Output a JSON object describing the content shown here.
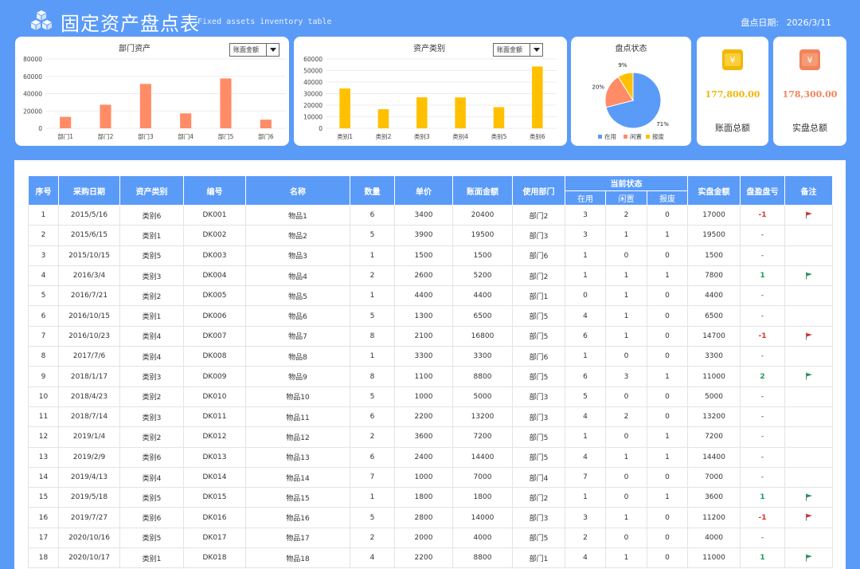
{
  "header": {
    "title": "固定资产盘点表",
    "subtitle": "Fixed assets inventory table",
    "date_label": "盘点日期:",
    "date_value": "2026/3/11"
  },
  "charts": {
    "dept": {
      "title": "部门资产",
      "dropdown": "账面金额"
    },
    "category": {
      "title": "资产类别",
      "dropdown": "账面金额"
    },
    "status": {
      "title": "盘点状态"
    }
  },
  "stats": {
    "book": {
      "value": "177,800.00",
      "label": "账面总额",
      "color": "#f2b705"
    },
    "actual": {
      "value": "178,300.00",
      "label": "实盘总额",
      "color": "#f0845a"
    }
  },
  "colors": {
    "accent": "#5b9bf8",
    "bar_orange": "#ff8c66",
    "bar_yellow": "#ffc000",
    "pie_blue": "#5b9bf8",
    "pie_orange": "#ff8c66",
    "pie_yellow": "#ffc000",
    "loss_red": "#e02b2b",
    "gain_green": "#1a9b58"
  },
  "chart_data": [
    {
      "type": "bar",
      "title": "部门资产",
      "categories": [
        "部门1",
        "部门2",
        "部门3",
        "部门4",
        "部门5",
        "部门6"
      ],
      "values": [
        13200,
        27200,
        51200,
        17200,
        57500,
        10000
      ],
      "ylim": [
        0,
        80000
      ],
      "yticks": [
        "0",
        "20000",
        "40000",
        "60000",
        "80000"
      ],
      "grid": true
    },
    {
      "type": "bar",
      "title": "资产类别",
      "categories": [
        "类别1",
        "类别2",
        "类别3",
        "类别4",
        "类别5",
        "类别6"
      ],
      "values": [
        34500,
        16500,
        26800,
        26700,
        18300,
        53500
      ],
      "ylim": [
        0,
        60000
      ],
      "yticks": [
        "0",
        "10000",
        "20000",
        "30000",
        "40000",
        "50000",
        "60000"
      ],
      "grid": true
    },
    {
      "type": "pie",
      "title": "盘点状态",
      "categories": [
        "在用",
        "闲置",
        "报废"
      ],
      "values": [
        71,
        20,
        9
      ],
      "labels": [
        "71%",
        "20%",
        "9%"
      ],
      "legend": "bottom"
    }
  ],
  "table": {
    "headers": [
      "序号",
      "采购日期",
      "资产类别",
      "编号",
      "名称",
      "数量",
      "单价",
      "账面金额",
      "使用部门",
      "当前状态",
      "实盘金额",
      "盘盈盘亏",
      "备注"
    ],
    "sub_headers": [
      "在用",
      "闲置",
      "报废"
    ],
    "rows": [
      {
        "no": "1",
        "date": "2015/5/16",
        "cat": "类别6",
        "code": "DK001",
        "name": "物品1",
        "qty": "6",
        "price": "3400",
        "book": "20400",
        "dept": "部门2",
        "inuse": "3",
        "idle": "2",
        "scrap": "0",
        "actual": "17000",
        "diff": "-1",
        "flag": "red"
      },
      {
        "no": "2",
        "date": "2015/6/15",
        "cat": "类别1",
        "code": "DK002",
        "name": "物品2",
        "qty": "5",
        "price": "3900",
        "book": "19500",
        "dept": "部门3",
        "inuse": "3",
        "idle": "1",
        "scrap": "1",
        "actual": "19500",
        "diff": "-",
        "flag": ""
      },
      {
        "no": "3",
        "date": "2015/10/15",
        "cat": "类别5",
        "code": "DK003",
        "name": "物品3",
        "qty": "1",
        "price": "1500",
        "book": "1500",
        "dept": "部门6",
        "inuse": "1",
        "idle": "0",
        "scrap": "0",
        "actual": "1500",
        "diff": "-",
        "flag": ""
      },
      {
        "no": "4",
        "date": "2016/3/4",
        "cat": "类别3",
        "code": "DK004",
        "name": "物品4",
        "qty": "2",
        "price": "2600",
        "book": "5200",
        "dept": "部门2",
        "inuse": "1",
        "idle": "1",
        "scrap": "1",
        "actual": "7800",
        "diff": "1",
        "flag": "green"
      },
      {
        "no": "5",
        "date": "2016/7/21",
        "cat": "类别2",
        "code": "DK005",
        "name": "物品5",
        "qty": "1",
        "price": "4400",
        "book": "4400",
        "dept": "部门1",
        "inuse": "0",
        "idle": "1",
        "scrap": "0",
        "actual": "4400",
        "diff": "-",
        "flag": ""
      },
      {
        "no": "6",
        "date": "2016/10/15",
        "cat": "类别1",
        "code": "DK006",
        "name": "物品6",
        "qty": "5",
        "price": "1300",
        "book": "6500",
        "dept": "部门5",
        "inuse": "4",
        "idle": "1",
        "scrap": "0",
        "actual": "6500",
        "diff": "-",
        "flag": ""
      },
      {
        "no": "7",
        "date": "2016/10/23",
        "cat": "类别4",
        "code": "DK007",
        "name": "物品7",
        "qty": "8",
        "price": "2100",
        "book": "16800",
        "dept": "部门5",
        "inuse": "6",
        "idle": "1",
        "scrap": "0",
        "actual": "14700",
        "diff": "-1",
        "flag": "red"
      },
      {
        "no": "8",
        "date": "2017/7/6",
        "cat": "类别4",
        "code": "DK008",
        "name": "物品8",
        "qty": "1",
        "price": "3300",
        "book": "3300",
        "dept": "部门6",
        "inuse": "1",
        "idle": "0",
        "scrap": "0",
        "actual": "3300",
        "diff": "-",
        "flag": ""
      },
      {
        "no": "9",
        "date": "2018/1/17",
        "cat": "类别3",
        "code": "DK009",
        "name": "物品9",
        "qty": "8",
        "price": "1100",
        "book": "8800",
        "dept": "部门5",
        "inuse": "6",
        "idle": "3",
        "scrap": "1",
        "actual": "11000",
        "diff": "2",
        "flag": "green"
      },
      {
        "no": "10",
        "date": "2018/4/23",
        "cat": "类别2",
        "code": "DK010",
        "name": "物品10",
        "qty": "5",
        "price": "1000",
        "book": "5000",
        "dept": "部门3",
        "inuse": "5",
        "idle": "0",
        "scrap": "0",
        "actual": "5000",
        "diff": "-",
        "flag": ""
      },
      {
        "no": "11",
        "date": "2018/7/14",
        "cat": "类别3",
        "code": "DK011",
        "name": "物品11",
        "qty": "6",
        "price": "2200",
        "book": "13200",
        "dept": "部门3",
        "inuse": "4",
        "idle": "2",
        "scrap": "0",
        "actual": "13200",
        "diff": "-",
        "flag": ""
      },
      {
        "no": "12",
        "date": "2019/1/4",
        "cat": "类别2",
        "code": "DK012",
        "name": "物品12",
        "qty": "2",
        "price": "3600",
        "book": "7200",
        "dept": "部门5",
        "inuse": "1",
        "idle": "0",
        "scrap": "1",
        "actual": "7200",
        "diff": "-",
        "flag": ""
      },
      {
        "no": "13",
        "date": "2019/2/9",
        "cat": "类别6",
        "code": "DK013",
        "name": "物品13",
        "qty": "6",
        "price": "2400",
        "book": "14400",
        "dept": "部门5",
        "inuse": "4",
        "idle": "1",
        "scrap": "1",
        "actual": "14400",
        "diff": "-",
        "flag": ""
      },
      {
        "no": "14",
        "date": "2019/4/13",
        "cat": "类别4",
        "code": "DK014",
        "name": "物品14",
        "qty": "7",
        "price": "1000",
        "book": "7000",
        "dept": "部门4",
        "inuse": "7",
        "idle": "0",
        "scrap": "0",
        "actual": "7000",
        "diff": "-",
        "flag": ""
      },
      {
        "no": "15",
        "date": "2019/5/18",
        "cat": "类别5",
        "code": "DK015",
        "name": "物品15",
        "qty": "1",
        "price": "1800",
        "book": "1800",
        "dept": "部门2",
        "inuse": "1",
        "idle": "0",
        "scrap": "1",
        "actual": "3600",
        "diff": "1",
        "flag": "green"
      },
      {
        "no": "16",
        "date": "2019/7/27",
        "cat": "类别6",
        "code": "DK016",
        "name": "物品16",
        "qty": "5",
        "price": "2800",
        "book": "14000",
        "dept": "部门3",
        "inuse": "3",
        "idle": "1",
        "scrap": "0",
        "actual": "11200",
        "diff": "-1",
        "flag": "red"
      },
      {
        "no": "17",
        "date": "2020/10/16",
        "cat": "类别5",
        "code": "DK017",
        "name": "物品17",
        "qty": "2",
        "price": "2000",
        "book": "4000",
        "dept": "部门5",
        "inuse": "2",
        "idle": "0",
        "scrap": "0",
        "actual": "4000",
        "diff": "-",
        "flag": ""
      },
      {
        "no": "18",
        "date": "2020/10/17",
        "cat": "类别1",
        "code": "DK018",
        "name": "物品18",
        "qty": "4",
        "price": "2200",
        "book": "8800",
        "dept": "部门1",
        "inuse": "4",
        "idle": "1",
        "scrap": "0",
        "actual": "11000",
        "diff": "1",
        "flag": "green"
      }
    ]
  }
}
